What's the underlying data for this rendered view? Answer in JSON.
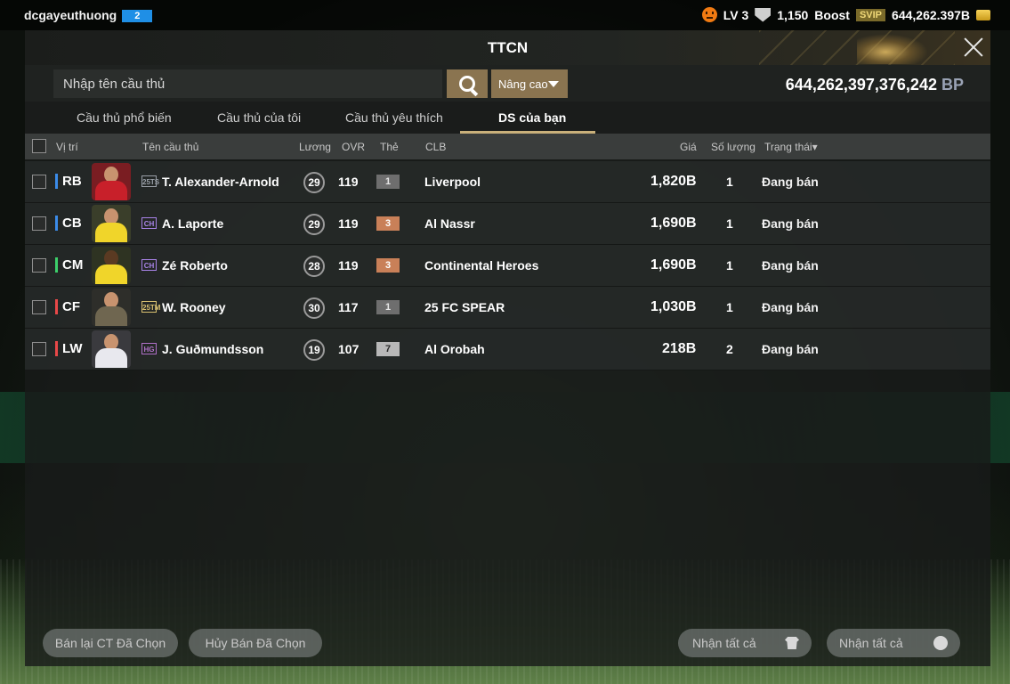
{
  "topbar": {
    "username": "dcgayeuthuong",
    "badge": "2",
    "level": "LV 3",
    "points": "1,150",
    "boost": "Boost",
    "svip": "SVIP",
    "currency": "644,262.397B"
  },
  "window": {
    "title": "TTCN"
  },
  "search": {
    "placeholder": "Nhập tên cầu thủ",
    "advanced_label": "Nâng cao"
  },
  "balance": {
    "amount": "644,262,397,376,242",
    "unit": "BP"
  },
  "tabs": [
    {
      "label": "Cầu thủ phổ biến"
    },
    {
      "label": "Cầu thủ của tôi"
    },
    {
      "label": "Cầu thủ yêu thích"
    },
    {
      "label": "DS của bạn"
    }
  ],
  "columns": {
    "position": "Vị trí",
    "name": "Tên cầu thủ",
    "pay": "Lương",
    "ovr": "OVR",
    "grade": "Thẻ",
    "club": "CLB",
    "price": "Giá",
    "quantity": "Số lượng",
    "status": "Trạng thái▾"
  },
  "rows": [
    {
      "position": "RB",
      "season": "25TS",
      "name": "T. Alexander-Arnold",
      "pay": "29",
      "ovr": "119",
      "grade": "1",
      "club": "Liverpool",
      "price": "1,820B",
      "quantity": "1",
      "status": "Đang bán"
    },
    {
      "position": "CB",
      "season": "CH",
      "name": "A. Laporte",
      "pay": "29",
      "ovr": "119",
      "grade": "3",
      "club": "Al Nassr",
      "price": "1,690B",
      "quantity": "1",
      "status": "Đang bán"
    },
    {
      "position": "CM",
      "season": "CH",
      "name": "Zé Roberto",
      "pay": "28",
      "ovr": "119",
      "grade": "3",
      "club": "Continental Heroes",
      "price": "1,690B",
      "quantity": "1",
      "status": "Đang bán"
    },
    {
      "position": "CF",
      "season": "25TM",
      "name": "W. Rooney",
      "pay": "30",
      "ovr": "117",
      "grade": "1",
      "club": "25 FC SPEAR",
      "price": "1,030B",
      "quantity": "1",
      "status": "Đang bán"
    },
    {
      "position": "LW",
      "season": "HG",
      "name": "J. Guðmundsson",
      "pay": "19",
      "ovr": "107",
      "grade": "7",
      "club": "Al Orobah",
      "price": "218B",
      "quantity": "2",
      "status": "Đang bán"
    }
  ],
  "bottom": {
    "resell": "Bán lại CT Đã Chọn",
    "cancel": "Hủy Bán Đã Chọn",
    "receive_all_players": "Nhận tất cả",
    "receive_all_bp": "Nhận tất cả"
  }
}
